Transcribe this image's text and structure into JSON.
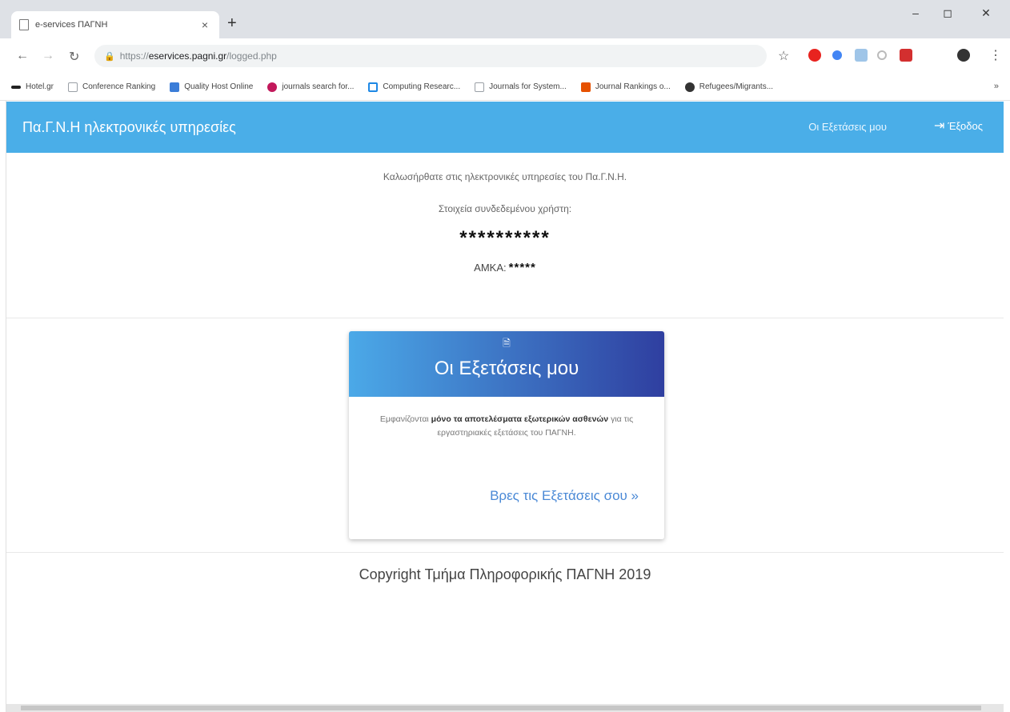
{
  "browser": {
    "tab_title": "e-services ΠΑΓΝΗ",
    "url_scheme": "https://",
    "url_host": "eservices.pagni.gr",
    "url_path": "/logged.php",
    "bookmarks": [
      {
        "label": "Hotel.gr",
        "icon_color": "#222"
      },
      {
        "label": "Conference Ranking",
        "icon_color": "#9aa0a6"
      },
      {
        "label": "Quality Host Online",
        "icon_color": "#3b7dd8"
      },
      {
        "label": "journals search for...",
        "icon_color": "#c2185b"
      },
      {
        "label": "Computing Researc...",
        "icon_color": "#1e88e5"
      },
      {
        "label": "Journals for System...",
        "icon_color": "#9aa0a6"
      },
      {
        "label": "Journal Rankings o...",
        "icon_color": "#e65100"
      },
      {
        "label": "Refugees/Migrants...",
        "icon_color": "#333"
      }
    ],
    "bookmarks_more": "»"
  },
  "page": {
    "brand": "Πα.Γ.Ν.Η ηλεκτρονικές υπηρεσίες",
    "nav_link": "Οι Εξετάσεις μου",
    "logout": "Έξοδος",
    "welcome": "Καλωσήρθατε στις ηλεκτρονικές υπηρεσίες του Πα.Γ.Ν.Η.",
    "user_label": "Στοιχεία συνδεδεμένου χρήστη:",
    "user_name": "**********",
    "amka_label": "ΑΜΚΑ:",
    "amka_value": "*****",
    "card": {
      "title": "Οι Εξετάσεις μου",
      "text_1": "Εμφανίζονται ",
      "text_bold": "μόνο τα αποτελέσματα εξωτερικών ασθενών",
      "text_2": " για τις εργαστηριακές εξετάσεις του ΠΑΓΝΗ.",
      "link": "Βρες τις Εξετάσεις σου »"
    },
    "copyright": "Copyright Τμήμα Πληροφορικής ΠΑΓΝΗ 2019"
  }
}
